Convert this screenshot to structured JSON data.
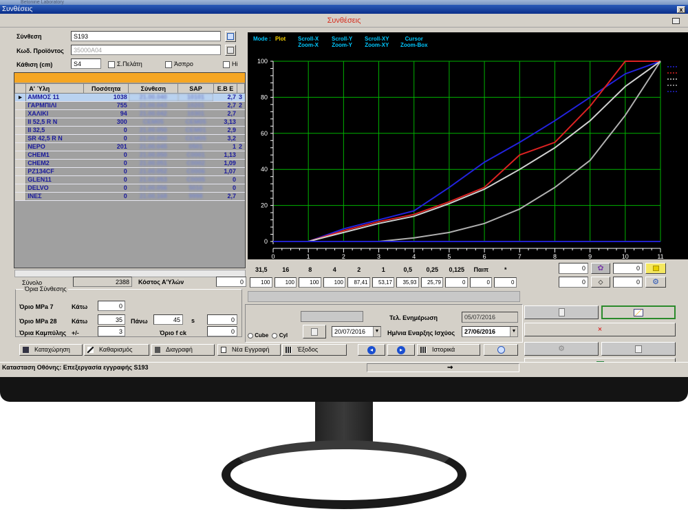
{
  "window": {
    "app_title": "Betonine Laboratory",
    "form_title": "Συνθέσεις",
    "header_title": "Συνθέσεις",
    "close_glyph": "x"
  },
  "form": {
    "synthesis_label": "Σύνθεση",
    "synthesis_value": "S193",
    "product_code_label": "Κωδ. Προϊόντος",
    "product_code_value": "35000A04",
    "slump_label": "Κάθιση (cm)",
    "slump_value": "S4",
    "chk_client": "Σ.Πελάτη",
    "chk_white": "Άσπρο",
    "chk_hi": "Hi"
  },
  "grid": {
    "columns": [
      "A' Ύλη",
      "Ποσότητα",
      "Σύνθεση",
      "SAP",
      "E.B E"
    ],
    "rows": [
      {
        "material": "ΑΜΜΟΣ 11",
        "qty": "1038",
        "synth": "21.00.040",
        "sap": "10101",
        "eb": "2,7",
        "extra": "3"
      },
      {
        "material": "ΓΑΡΜΠΙΛΙ",
        "qty": "755",
        "synth": "21.00.043",
        "sap": "10201",
        "eb": "2,7",
        "extra": "2"
      },
      {
        "material": "ΧΑΛΙΚΙ",
        "qty": "94",
        "synth": "21.00.042",
        "sap": "10301",
        "eb": "2,7",
        "extra": ""
      },
      {
        "material": "II 52,5 R N",
        "qty": "300",
        "synth": "CEM05",
        "sap": "CEM05",
        "eb": "3,13",
        "extra": ""
      },
      {
        "material": "II 32,5",
        "qty": "0",
        "synth": "21.00.050",
        "sap": "CEM01",
        "eb": "2,9",
        "extra": ""
      },
      {
        "material": "SR 42,5 R N",
        "qty": "0",
        "synth": "21.00.050",
        "sap": "CEM05",
        "eb": "3,2",
        "extra": ""
      },
      {
        "material": "ΝΕΡΟ",
        "qty": "201",
        "synth": "21.00.045",
        "sap": "0501",
        "eb": "1",
        "extra": "2"
      },
      {
        "material": "CHEM1",
        "qty": "0",
        "synth": "21.00.050",
        "sap": "C0001",
        "eb": "1,13",
        "extra": ""
      },
      {
        "material": "CHEM2",
        "qty": "0",
        "synth": "21.00.051",
        "sap": "C0002",
        "eb": "1,09",
        "extra": ""
      },
      {
        "material": "PZ134CF",
        "qty": "0",
        "synth": "21.00.052",
        "sap": "C0006",
        "eb": "1,07",
        "extra": ""
      },
      {
        "material": "GLEN11",
        "qty": "0",
        "synth": "21.00.053",
        "sap": "C0005",
        "eb": "0",
        "extra": ""
      },
      {
        "material": "DELVO",
        "qty": "0",
        "synth": "21.00.056",
        "sap": "5016",
        "eb": "0",
        "extra": ""
      },
      {
        "material": "ΙΝΕΣ",
        "qty": "0",
        "synth": "21.00.168",
        "sap": "9998",
        "eb": "2,7",
        "extra": ""
      }
    ]
  },
  "totals": {
    "sum_label": "Σύνολο",
    "sum_value": "2388",
    "cost_label": "Κόστος Α'Υλών",
    "cost_value": "0"
  },
  "limits": {
    "group_title": "Όρια Σύνθεσης",
    "mpa7_label": "Όριο MPa 7",
    "below_label": "Κάτω",
    "mpa7_low": "0",
    "mpa28_label": "Όριο MPa 28",
    "mpa28_low": "35",
    "above_label": "Πάνω",
    "mpa28_high": "45",
    "s_label": "s",
    "s_value": "0",
    "curve_label": "Όρια Καμπύλης",
    "plusminus_label": "+/-",
    "curve_value": "3",
    "fck_label": "Όριο  f ck",
    "fck_value": "0"
  },
  "chart_controls": {
    "mode_label": "Mode :",
    "mode_value": "Plot",
    "scroll_x": "Scroll-X",
    "zoom_x": "Zoom-X",
    "scroll_y": "Scroll-Y",
    "zoom_y": "Zoom-Y",
    "scroll_xy": "Scroll-XY",
    "zoom_xy": "Zoom-XY",
    "cursor": "Cursor",
    "zoom_box": "Zoom-Box"
  },
  "chart_data": {
    "type": "line",
    "title": "",
    "xlabel": "",
    "ylabel": "",
    "xlim": [
      0,
      11
    ],
    "ylim": [
      0,
      100
    ],
    "x_ticks": [
      "0",
      "1",
      "2",
      "3",
      "4",
      "5",
      "6",
      "7",
      "8",
      "9",
      "10",
      "11"
    ],
    "y_ticks": [
      "0",
      "20",
      "40",
      "60",
      "80",
      "100"
    ],
    "grid": true,
    "legend_placement": "right",
    "series": [
      {
        "color": "#2222dd",
        "x": [
          1,
          2,
          3,
          4,
          5,
          6,
          7,
          8,
          9,
          10,
          11
        ],
        "y": [
          0,
          7,
          12,
          17,
          30,
          44,
          55,
          67,
          80,
          93,
          100
        ]
      },
      {
        "color": "#dd2222",
        "x": [
          1,
          2,
          3,
          4,
          5,
          6,
          7,
          8,
          9,
          10,
          11
        ],
        "y": [
          0,
          6,
          11,
          15,
          22,
          30,
          48,
          55,
          75,
          100,
          100
        ]
      },
      {
        "color": "#d0d0d0",
        "x": [
          1,
          2,
          3,
          4,
          5,
          6,
          7,
          8,
          9,
          10,
          11
        ],
        "y": [
          0,
          5,
          10,
          14,
          21,
          29,
          40,
          52,
          67,
          86,
          100
        ]
      },
      {
        "color": "#b0b0b0",
        "x": [
          1,
          2,
          3,
          4,
          5,
          6,
          7,
          8,
          9,
          10,
          11
        ],
        "y": [
          0,
          0,
          0,
          2,
          5,
          10,
          18,
          30,
          45,
          70,
          100
        ]
      },
      {
        "color": "#2222cc",
        "x": [
          0,
          11
        ],
        "y": [
          0,
          0
        ]
      }
    ]
  },
  "sieves": {
    "sizes": [
      "31,5",
      "16",
      "8",
      "4",
      "2",
      "1",
      "0,5",
      "0,25",
      "0,125",
      "Παιπ",
      "*"
    ],
    "values": [
      "100",
      "100",
      "100",
      "100",
      "87,41",
      "53,17",
      "35,93",
      "25,79",
      "0",
      "0",
      "0"
    ]
  },
  "right_panel": {
    "v1": "0",
    "v2": "0",
    "v3": "0",
    "v4": "0"
  },
  "lower_center": {
    "cube_label": "Cube",
    "cyl_label": "Cyl",
    "date_field_1": "20/07/2016",
    "last_update_label": "Τελ. Ενημέρωση",
    "last_update_value": "05/07/2016",
    "start_date_label": "Ημ/νια Εναρξης Ισχύος",
    "start_date_value": "27/06/2016"
  },
  "buttons": {
    "save": "Καταχώρηση",
    "clear": "Καθαρισμός",
    "delete": "Διαγραφή",
    "new": "Νέα Εγγραφή",
    "exit": "Έξοδος",
    "history": "Ιστορικά",
    "red_x": "×"
  },
  "status": {
    "text": "Κατασταση Οθόνης: Επεξεργασία εγγραφής S193"
  }
}
